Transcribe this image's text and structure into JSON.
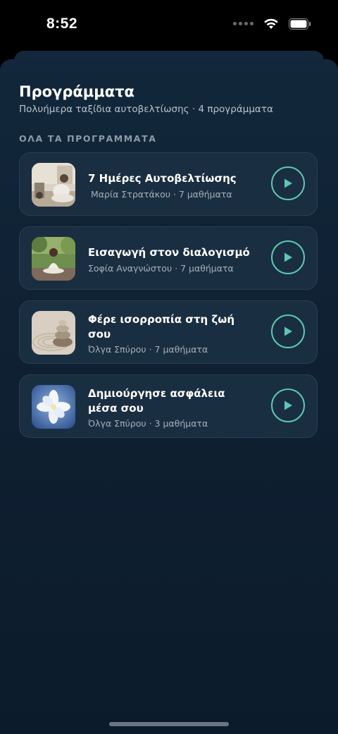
{
  "status_bar": {
    "time": "8:52",
    "icons": [
      "signal-dots-icon",
      "wifi-icon",
      "battery-icon"
    ]
  },
  "header": {
    "title": "Προγράμματα",
    "subtitle": "Πολυήμερα ταξίδια αυτοβελτίωσης · 4 προγράμματα"
  },
  "section": {
    "label": "ΟΛΑ ΤΑ ΠΡΟΓΡΑΜΜΑΤΑ"
  },
  "programs": [
    {
      "title": "7 Ημέρες Αυτοβελτίωσης",
      "meta": "Μαρία Στρατάκου · 7 μαθήματα",
      "thumbnail": "woman-sitting-at-home-image"
    },
    {
      "title": "Εισαγωγή στον διαλογισμό",
      "meta": "Σοφία Αναγνώστου · 7 μαθήματα",
      "thumbnail": "woman-meditating-outdoors-image"
    },
    {
      "title": "Φέρε ισορροπία στη ζωή σου",
      "meta": "Όλγα Σπύρου · 7 μαθήματα",
      "thumbnail": "stacked-zen-stones-image"
    },
    {
      "title": "Δημιούργησε ασφάλεια μέσα σου",
      "meta": "Όλγα Σπύρου · 3 μαθήματα",
      "thumbnail": "white-flower-on-blue-image"
    }
  ],
  "colors": {
    "background": "#0f2133",
    "card": "#1a2e41",
    "accent": "#5fc6b3",
    "text_primary": "#ffffff",
    "text_secondary": "#a4b0bc"
  }
}
